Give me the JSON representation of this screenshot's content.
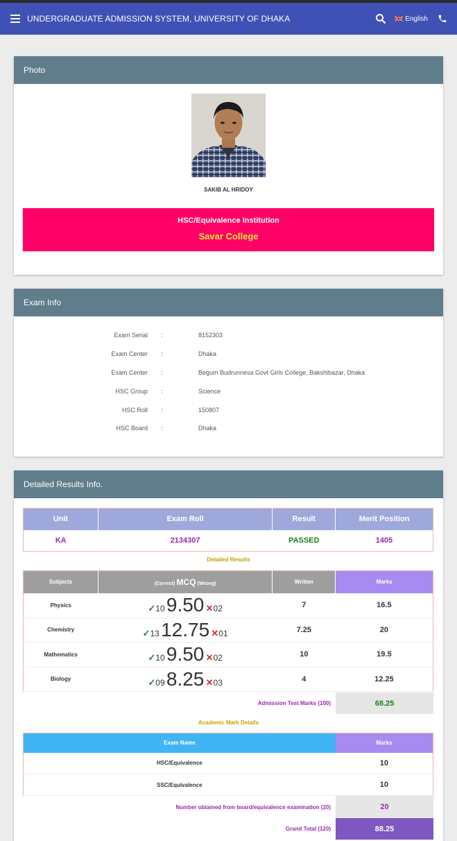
{
  "header": {
    "title": "UNDERGRADUATE ADMISSION SYSTEM, UNIVERSITY OF DHAKA",
    "language": "English"
  },
  "photo_card": {
    "title": "Photo",
    "student_name": "SAKIB AL HRIDOY",
    "institution_label": "HSC/Equivalence Institution",
    "institution_value": "Savar College"
  },
  "exam_card": {
    "title": "Exam Info",
    "rows": [
      {
        "label": "Exam Serial",
        "value": "8152303"
      },
      {
        "label": "Exam Center",
        "value": "Dhaka"
      },
      {
        "label": "Exam Center",
        "value": "Begum Budrunnesa Govt Girls College, Bakshibazar, Dhaka"
      },
      {
        "label": "HSC Group",
        "value": "Science"
      },
      {
        "label": "HSC Roll",
        "value": "150807"
      },
      {
        "label": "HSC Board",
        "value": "Dhaka"
      }
    ]
  },
  "results_card": {
    "title": "Detailed Results Info.",
    "summary_headers": [
      "Unit",
      "Exam Roll",
      "Result",
      "Merit Position"
    ],
    "summary": {
      "unit": "KA",
      "exam_roll": "2134307",
      "result": "PASSED",
      "merit_position": "1405"
    },
    "detailed_title": "Detailed Results",
    "detail_headers": {
      "subjects": "Subjects",
      "mcq_pre": "(Correct)",
      "mcq": "MCQ",
      "mcq_post": "(Wrong)",
      "written": "Written",
      "marks": "Marks"
    },
    "subjects": [
      {
        "name": "Physics",
        "correct": "10",
        "mcq": "9.50",
        "wrong": "02",
        "written": "7",
        "marks": "16.5"
      },
      {
        "name": "Chemistry",
        "correct": "13",
        "mcq": "12.75",
        "wrong": "01",
        "written": "7.25",
        "marks": "20"
      },
      {
        "name": "Mathematics",
        "correct": "10",
        "mcq": "9.50",
        "wrong": "02",
        "written": "10",
        "marks": "19.5"
      },
      {
        "name": "Biology",
        "correct": "09",
        "mcq": "8.25",
        "wrong": "03",
        "written": "4",
        "marks": "12.25"
      }
    ],
    "admission_label": "Admission Test Marks (100)",
    "admission_value": "68.25",
    "academic_title": "Academic Mark Details",
    "academic_headers": {
      "exam_name": "Exam Name",
      "marks": "Marks"
    },
    "academic_rows": [
      {
        "name": "HSC/Equivalence",
        "marks": "10"
      },
      {
        "name": "SSC/Equivalence",
        "marks": "10"
      }
    ],
    "board_label": "Number obtained from board/equivalence examination (20)",
    "board_value": "20",
    "grand_label": "Grand Total (120)",
    "grand_value": "88.25"
  },
  "colors": {
    "appbar": "#3f51b5",
    "card_header": "#607d8b",
    "institution_box": "#ff0066",
    "passed": "#1b7f1b",
    "grand_total": "#7e57c2"
  }
}
